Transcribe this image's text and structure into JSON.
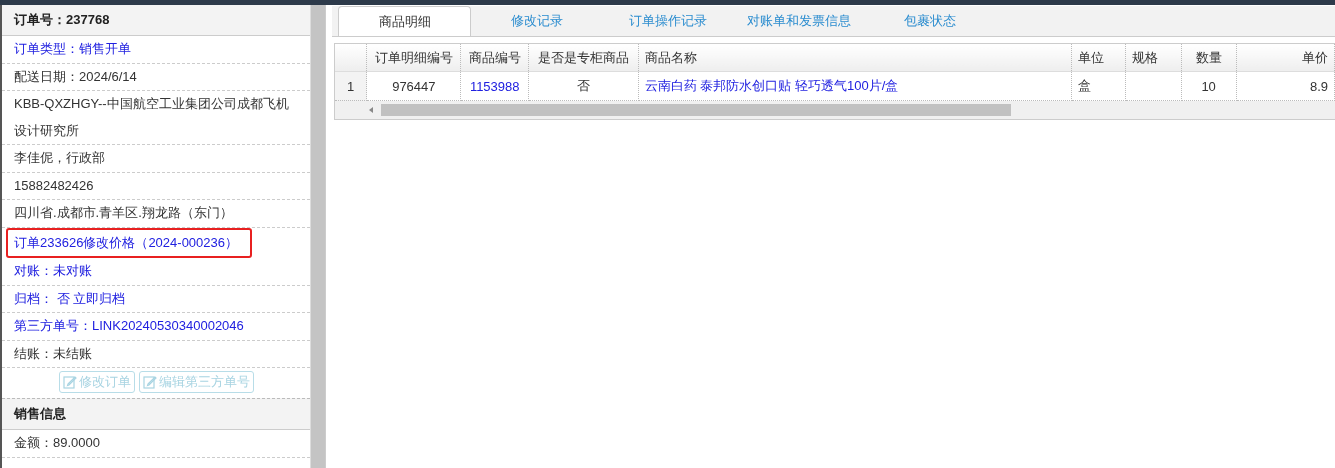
{
  "order_panel": {
    "title": "订单号：237768",
    "rows": [
      {
        "lines": [
          "订单类型：销售开单"
        ],
        "kind": "link",
        "highlighted": false
      },
      {
        "lines": [
          "配送日期：2024/6/14"
        ],
        "kind": "plain",
        "highlighted": false
      },
      {
        "lines": [
          "KBB-QXZHGY--中国航空工业集团公司成都飞机",
          "设计研究所"
        ],
        "kind": "plain",
        "highlighted": false
      },
      {
        "lines": [
          "李佳伲，行政部"
        ],
        "kind": "plain",
        "highlighted": false
      },
      {
        "lines": [
          "15882482426"
        ],
        "kind": "plain",
        "highlighted": false
      },
      {
        "lines": [
          "四川省.成都市.青羊区.翔龙路（东门）"
        ],
        "kind": "plain",
        "highlighted": false
      },
      {
        "lines": [
          "订单233626修改价格（2024-000236）"
        ],
        "kind": "link",
        "highlighted": true
      },
      {
        "lines": [
          "对账：未对账"
        ],
        "kind": "link",
        "highlighted": false
      },
      {
        "lines": [
          "归档： 否 立即归档"
        ],
        "kind": "link",
        "highlighted": false
      },
      {
        "lines": [
          "第三方单号：LINK20240530340002046"
        ],
        "kind": "link",
        "highlighted": false
      },
      {
        "lines": [
          "结账：未结账"
        ],
        "kind": "plain",
        "highlighted": false
      }
    ],
    "buttons": [
      {
        "label": "修改订单",
        "disabled": true
      },
      {
        "label": "编辑第三方单号",
        "disabled": true
      }
    ],
    "section": {
      "title": "销售信息",
      "rows": [
        "金额：89.0000"
      ]
    }
  },
  "tabs": [
    {
      "label": "商品明细",
      "selected": true
    },
    {
      "label": "修改记录",
      "selected": false
    },
    {
      "label": "订单操作记录",
      "selected": false
    },
    {
      "label": "对账单和发票信息",
      "selected": false
    },
    {
      "label": "包裹状态",
      "selected": false
    }
  ],
  "table": {
    "columns": [
      {
        "label": "订单明细编号"
      },
      {
        "label": "商品编号"
      },
      {
        "label": "是否是专柜商品"
      },
      {
        "label": "商品名称"
      },
      {
        "label": "单位"
      },
      {
        "label": "规格"
      },
      {
        "label": "数量"
      },
      {
        "label": "单价"
      }
    ],
    "rows": [
      {
        "row_number": "1",
        "cells": [
          {
            "text": "976447",
            "kind": "plain"
          },
          {
            "text": "1153988",
            "kind": "link"
          },
          {
            "text": "否",
            "kind": "plain"
          },
          {
            "text": "云南白药 泰邦防水创口贴 轻巧透气100片/盒",
            "kind": "link"
          },
          {
            "text": "盒",
            "kind": "plain"
          },
          {
            "text": "",
            "kind": "plain"
          },
          {
            "text": "10",
            "kind": "plain"
          },
          {
            "text": "8.9",
            "kind": "plain"
          }
        ]
      }
    ]
  }
}
